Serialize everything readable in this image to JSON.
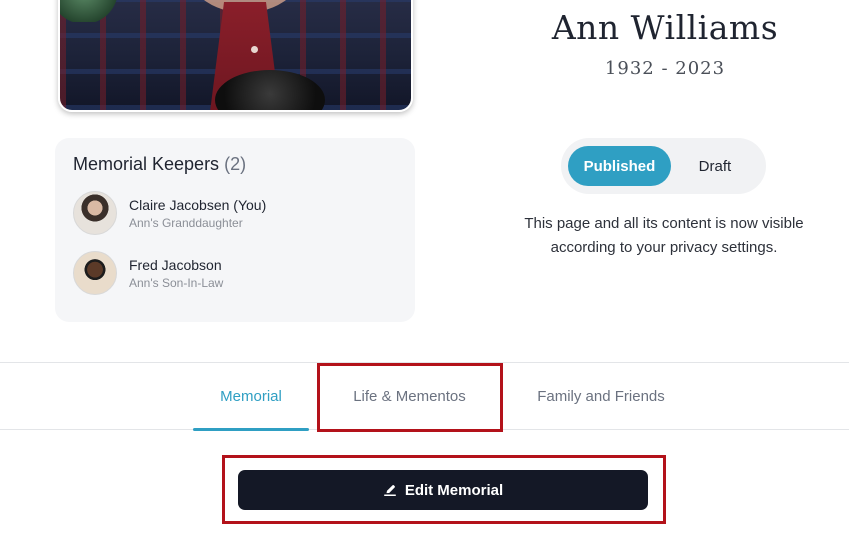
{
  "profile": {
    "name": "Ann Williams",
    "dates": "1932 - 2023",
    "photo_icon": "portrait-photo"
  },
  "keepers": {
    "title": "Memorial Keepers",
    "count": "(2)",
    "items": [
      {
        "name": "Claire Jacobsen (You)",
        "role": "Ann's Granddaughter",
        "avatar": "avatar-photo"
      },
      {
        "name": "Fred Jacobson",
        "role": "Ann's Son-In-Law",
        "avatar": "avatar-photo"
      }
    ]
  },
  "status": {
    "options": [
      "Published",
      "Draft"
    ],
    "selected": "Published",
    "notice": "This page and all its content is now visible according to your privacy settings."
  },
  "tabs": {
    "items": [
      "Memorial",
      "Life & Mementos",
      "Family and Friends"
    ],
    "active": "Memorial"
  },
  "actions": {
    "edit_label": "Edit Memorial",
    "edit_icon": "pencil-icon"
  },
  "colors": {
    "accent": "#2f9fc3",
    "button_dark": "#141826",
    "highlight": "#b3121a"
  }
}
